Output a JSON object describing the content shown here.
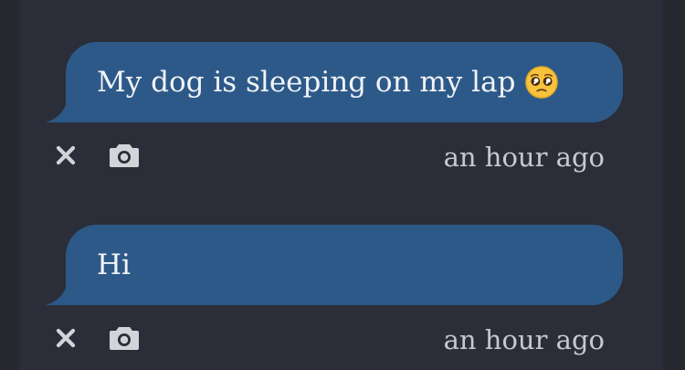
{
  "messages": [
    {
      "text": "My dog is sleeping on my lap",
      "emoji": "pleading-face",
      "timestamp": "an hour ago"
    },
    {
      "text": "Hi",
      "timestamp": "an hour ago"
    }
  ],
  "colors": {
    "background": "#2b2e38",
    "bubble": "#2d5989",
    "text": "#f1f3f6",
    "meta": "#c7c9cf"
  },
  "icons": {
    "delete": "close-icon",
    "photo": "camera-icon"
  }
}
